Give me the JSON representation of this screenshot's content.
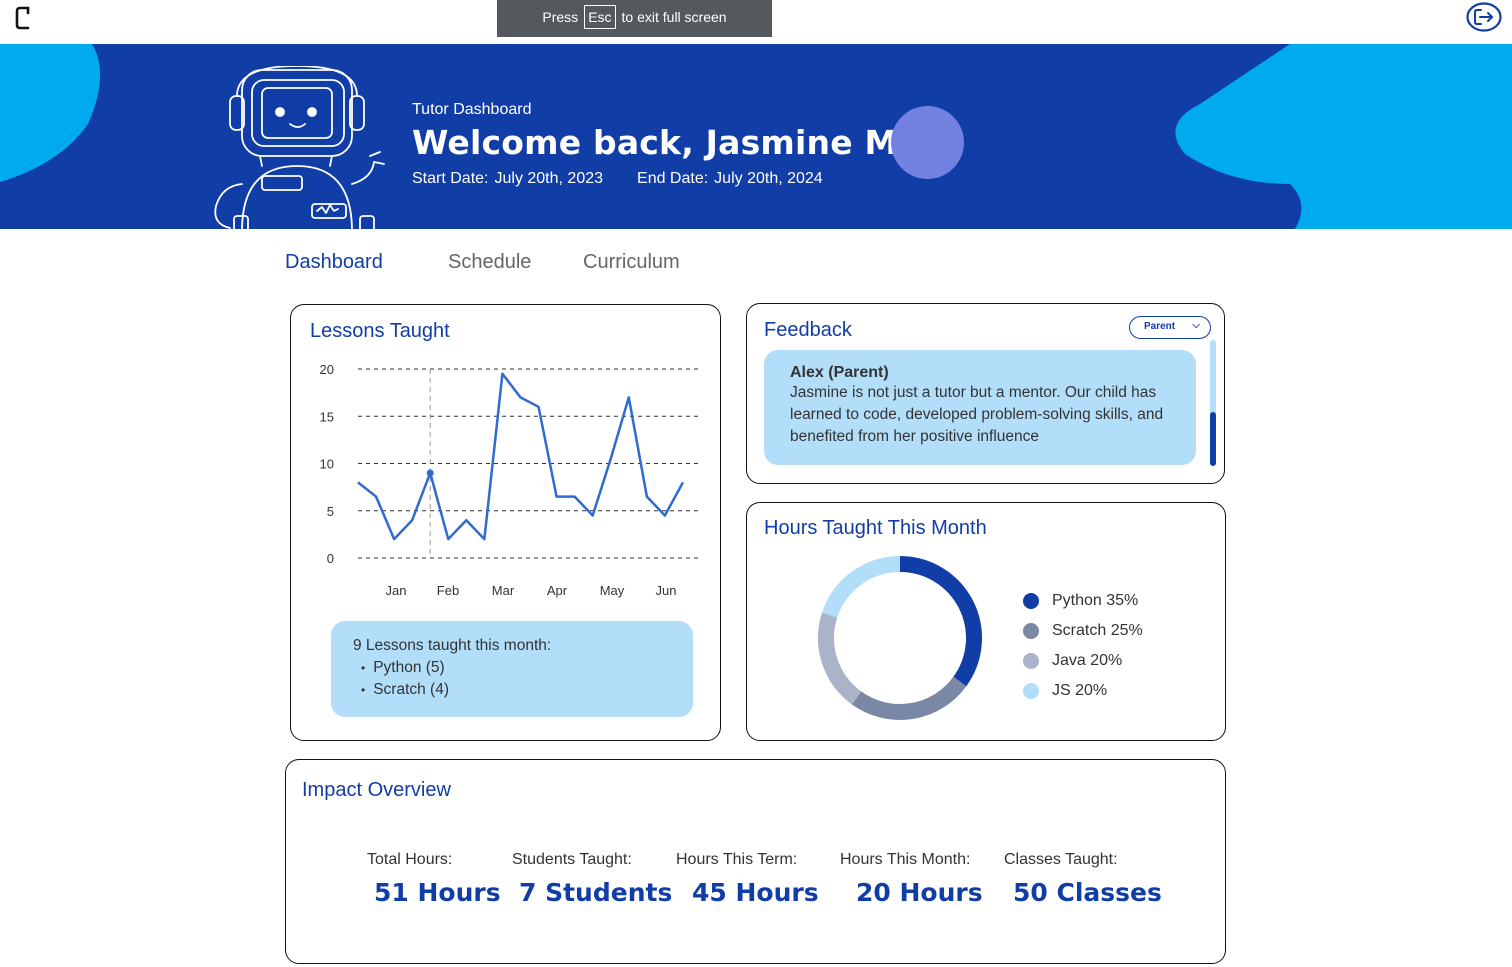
{
  "fullscreen_notice": {
    "press": "Press",
    "key": "Esc",
    "message": "to exit full screen"
  },
  "header": {
    "subtitle": "Tutor Dashboard",
    "welcome": "Welcome back, Jasmine May",
    "start_label": "Start Date:",
    "start_value": "July 20th, 2023",
    "end_label": "End Date:",
    "end_value": "July 20th, 2024"
  },
  "tabs": [
    {
      "label": "Dashboard",
      "active": true
    },
    {
      "label": "Schedule",
      "active": false
    },
    {
      "label": "Curriculum",
      "active": false
    }
  ],
  "lessons": {
    "title": "Lessons Taught",
    "note_heading": "9 Lessons taught this month:",
    "note_items": [
      "Python (5)",
      "Scratch (4)"
    ]
  },
  "chart_data": {
    "type": "line",
    "title": "Lessons Taught",
    "x_tick_labels": [
      "Jan",
      "Feb",
      "Mar",
      "Apr",
      "May",
      "Jun"
    ],
    "y_ticks": [
      0,
      5,
      10,
      15,
      20
    ],
    "ylim": [
      0,
      20
    ],
    "x": [
      0,
      0.4,
      0.8,
      1.2,
      1.6,
      2.0,
      2.4,
      2.8,
      3.2,
      3.6,
      4.0,
      4.4,
      4.8,
      5.2,
      5.6,
      6.0,
      6.4,
      6.8,
      7.2,
      7.6
    ],
    "values": [
      8,
      6.5,
      2,
      4,
      9,
      2,
      4,
      2,
      19.5,
      17,
      16,
      6.5,
      6.5,
      4.5,
      10.5,
      17,
      6.5,
      4.5,
      8
    ],
    "highlight_index": 4,
    "grid": "dashed horizontal",
    "color": "#2f6bd0"
  },
  "feedback": {
    "title": "Feedback",
    "filter": "Parent",
    "author": "Alex (Parent)",
    "text": "Jasmine is not just a tutor but a mentor. Our child has learned to code, developed problem-solving skills, and benefited from her positive influence"
  },
  "hours_month": {
    "title": "Hours Taught This Month",
    "legend": [
      {
        "label": "Python 35%",
        "value": 35,
        "color": "#113da6"
      },
      {
        "label": "Scratch 25%",
        "value": 25,
        "color": "#7a88a6"
      },
      {
        "label": "Java 20%",
        "value": 20,
        "color": "#aab3c8"
      },
      {
        "label": "JS 20%",
        "value": 20,
        "color": "#b3defa"
      }
    ]
  },
  "impact": {
    "title": "Impact Overview",
    "stats": [
      {
        "label": "Total Hours:",
        "value": "51 Hours"
      },
      {
        "label": "Students Taught:",
        "value": "7 Students"
      },
      {
        "label": "Hours This Term:",
        "value": "45 Hours"
      },
      {
        "label": "Hours This Month:",
        "value": "20 Hours"
      },
      {
        "label": "Classes Taught:",
        "value": "50 Classes"
      }
    ]
  },
  "icons": {
    "logo": "app-logo-icon",
    "exit": "logout-icon",
    "mascot": "robot-mascot-icon",
    "chevron": "chevron-down-icon"
  }
}
